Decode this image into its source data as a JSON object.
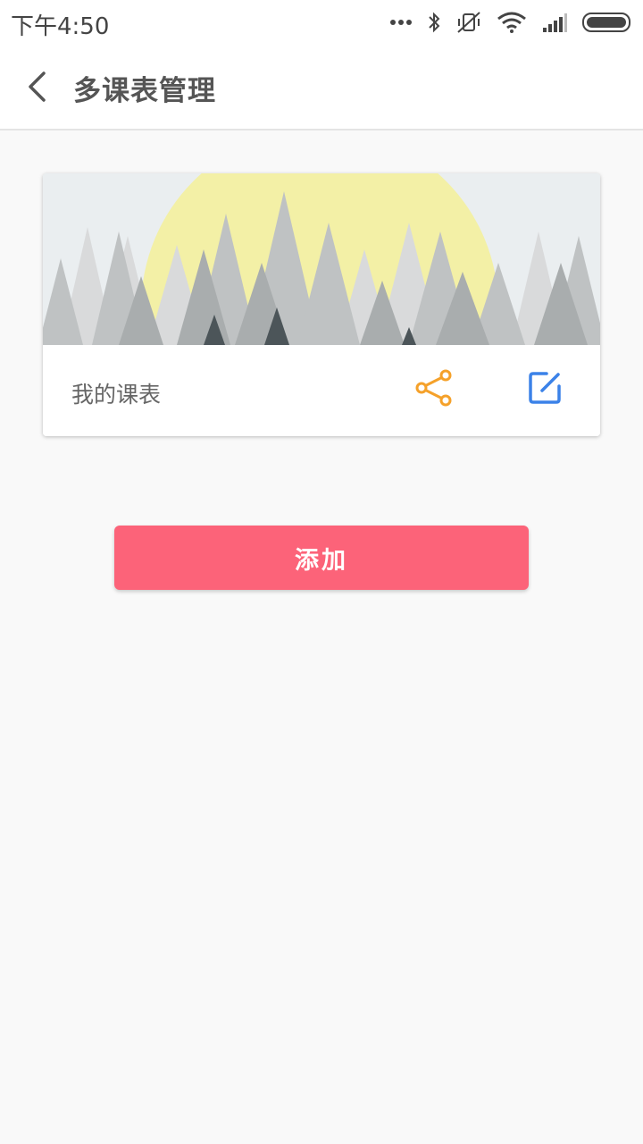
{
  "status_bar": {
    "time": "下午4:50",
    "icons": [
      "more-dots-icon",
      "bluetooth-icon",
      "vibrate-off-icon",
      "wifi-icon",
      "signal-icon",
      "battery-icon"
    ]
  },
  "app_bar": {
    "back_icon": "chevron-left-icon",
    "title": "多课表管理"
  },
  "schedules": [
    {
      "name": "我的课表",
      "banner": "forest-sun-illustration",
      "actions": [
        {
          "icon": "share-icon",
          "color": "#f5a12a"
        },
        {
          "icon": "edit-icon",
          "color": "#3b82e8"
        }
      ]
    }
  ],
  "add_button": {
    "label": "添加",
    "color": "#fc6379"
  },
  "colors": {
    "background": "#f9f9f9",
    "appbar": "#ffffff",
    "title_text": "#555555"
  }
}
